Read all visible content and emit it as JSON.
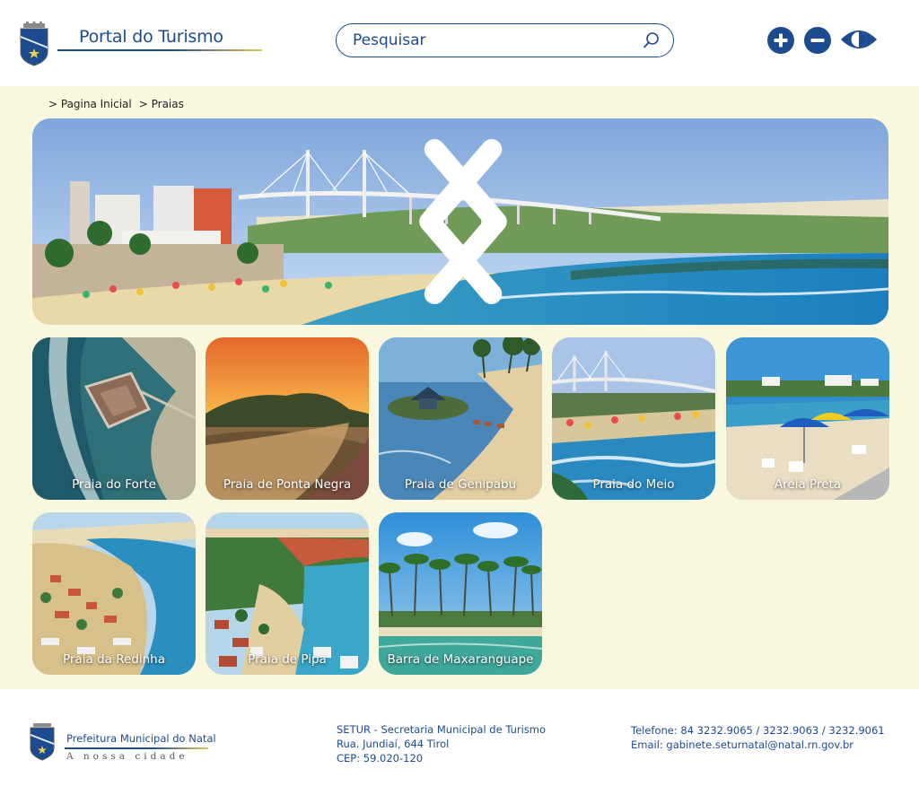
{
  "header": {
    "logo_title": "Portal do Turismo",
    "search": {
      "placeholder": "Pesquisar"
    },
    "accessibility": {
      "zoom_in_icon": "plus-circle-icon",
      "zoom_out_icon": "minus-circle-icon",
      "contrast_icon": "eye-contrast-icon"
    }
  },
  "breadcrumb": [
    "> Pagina Inicial",
    "> Praias"
  ],
  "banner": {
    "prev_icon": "chevron-left-icon",
    "next_icon": "chevron-right-icon"
  },
  "beaches": [
    {
      "label": "Praia do Forte"
    },
    {
      "label": "Praia de Ponta Negra"
    },
    {
      "label": "Praia de Genipabu"
    },
    {
      "label": "Praia do Meio"
    },
    {
      "label": "Areia Preta"
    },
    {
      "label": "Praia da Redinha"
    },
    {
      "label": "Praia de Pipa"
    },
    {
      "label": "Barra de Maxaranguape"
    }
  ],
  "footer": {
    "logo_title": "Prefeitura Municipal do Natal",
    "logo_subtitle": "A nossa cidade",
    "address": [
      "SETUR - Secretaria Municipal de Turismo",
      "Rua. Jundiaí, 644 Tirol",
      "CEP: 59.020-120"
    ],
    "contact": [
      "Telefone: 84 3232.9065 / 3232.9063 / 3232.9061",
      "Email: gabinete.seturnatal@natal.rn.gov.br"
    ]
  },
  "colors": {
    "brand": "#1c4b8f",
    "gold": "#e4c25a",
    "content_bg": "#f9f7de"
  }
}
